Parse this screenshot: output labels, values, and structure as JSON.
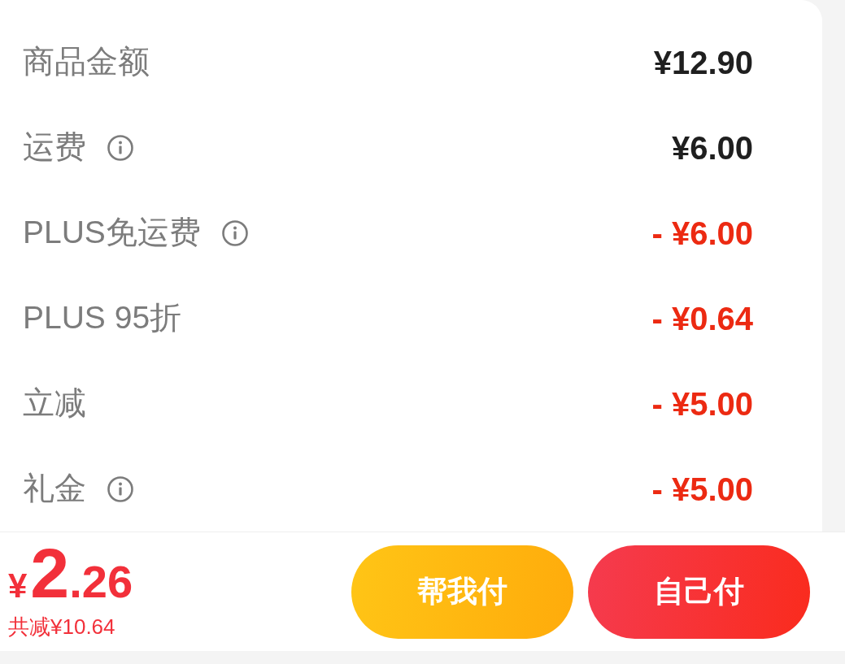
{
  "breakdown": {
    "rows": [
      {
        "label": "商品金额",
        "info": false,
        "kind": "charge",
        "value": "¥12.90"
      },
      {
        "label": "运费",
        "info": true,
        "kind": "charge",
        "value": "¥6.00"
      },
      {
        "label": "PLUS免运费",
        "info": true,
        "kind": "discount",
        "value": "- ¥6.00"
      },
      {
        "label": "PLUS 95折",
        "info": false,
        "kind": "discount",
        "value": "- ¥0.64"
      },
      {
        "label": "立减",
        "info": false,
        "kind": "discount",
        "value": "- ¥5.00"
      },
      {
        "label": "礼金",
        "info": true,
        "kind": "discount",
        "value": "- ¥5.00"
      }
    ]
  },
  "footer": {
    "total": {
      "currency": "¥",
      "integer": "2",
      "decimal": ".26"
    },
    "savings": "共减¥10.64",
    "buttons": [
      {
        "label": "帮我付",
        "kind": "secondary"
      },
      {
        "label": "自己付",
        "kind": "primary"
      }
    ]
  }
}
